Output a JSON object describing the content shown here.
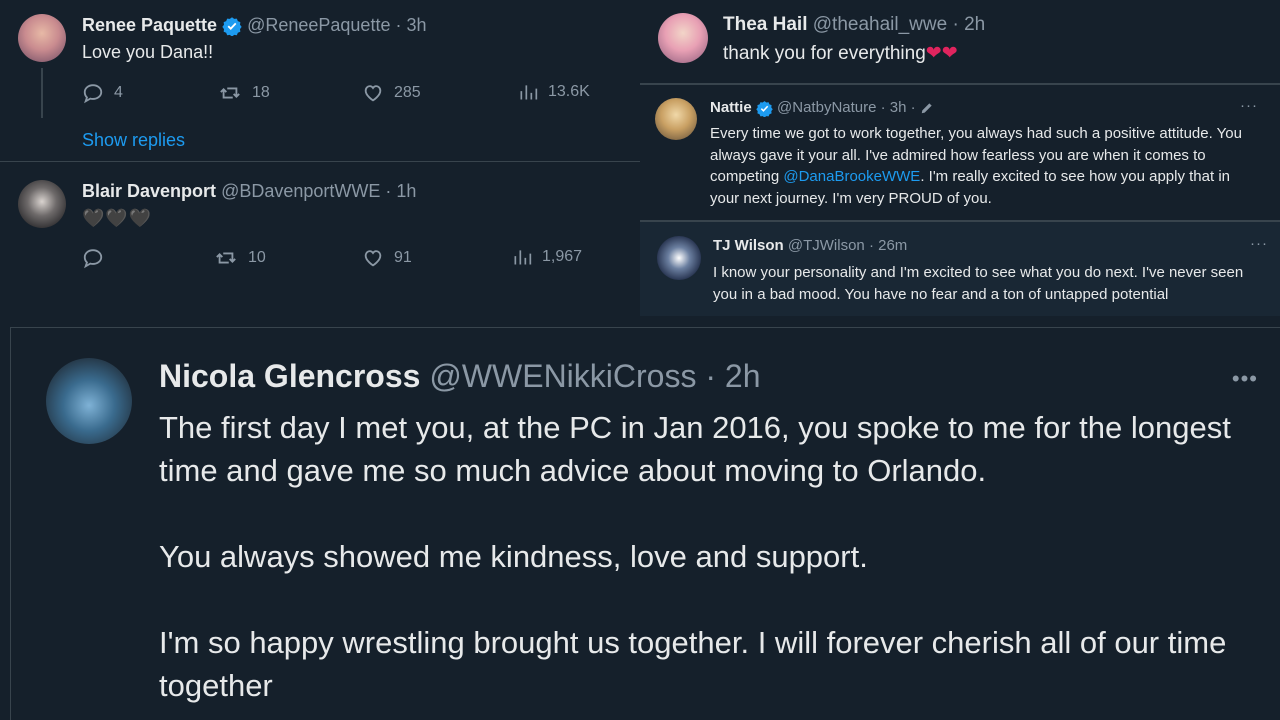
{
  "renee": {
    "name": "Renee Paquette",
    "handle": "@ReneePaquette",
    "time": "· 3h",
    "text": "Love you Dana!!",
    "replies": "4",
    "retweets": "18",
    "likes": "285",
    "views": "13.6K",
    "show_replies": "Show replies"
  },
  "blair": {
    "name": "Blair Davenport",
    "handle": "@BDavenportWWE",
    "time": "· 1h",
    "hearts": "🖤🖤🖤",
    "retweets": "10",
    "likes": "91",
    "views": "1,967"
  },
  "thea": {
    "name": "Thea Hail",
    "handle": "@theahail_wwe",
    "time": "· 2h",
    "text": "thank you for everything",
    "hearts": "❤❤"
  },
  "nattie": {
    "name": "Nattie",
    "handle": "@NatbyNature",
    "time": "· 3h ·",
    "text_before": "Every time we got to work together, you always had such a positive attitude. You always gave it your all. I've admired how fearless  you are when it comes to competing ",
    "mention": "@DanaBrookeWWE",
    "text_after": ".  I'm really excited to see how you apply that in your next journey. I'm very PROUD of you.",
    "more": "···"
  },
  "tj": {
    "name": "TJ Wilson",
    "handle": "@TJWilson",
    "time": "· 26m",
    "text": "I know your personality and I'm excited to see what you do next.  I've never seen you in a bad mood.  You have no fear and a ton of untapped potential",
    "more": "···"
  },
  "nicola": {
    "name": "Nicola Glencross",
    "handle": "@WWENikkiCross",
    "time": "· 2h",
    "p1": "The first day I met you, at the PC in Jan 2016, you spoke to me for the longest time and gave me so much advice about moving to Orlando.",
    "p2": "You always showed me kindness, love and support.",
    "p3": "I'm so happy wrestling brought us together. I will forever cherish all of our time together",
    "more": "•••"
  },
  "colors": {
    "background": "#15202b",
    "text": "#e7e9ea",
    "muted": "#8b98a5",
    "link": "#1d9bf0",
    "verified": "#1d9bf0",
    "heart_red": "#e0245e"
  }
}
